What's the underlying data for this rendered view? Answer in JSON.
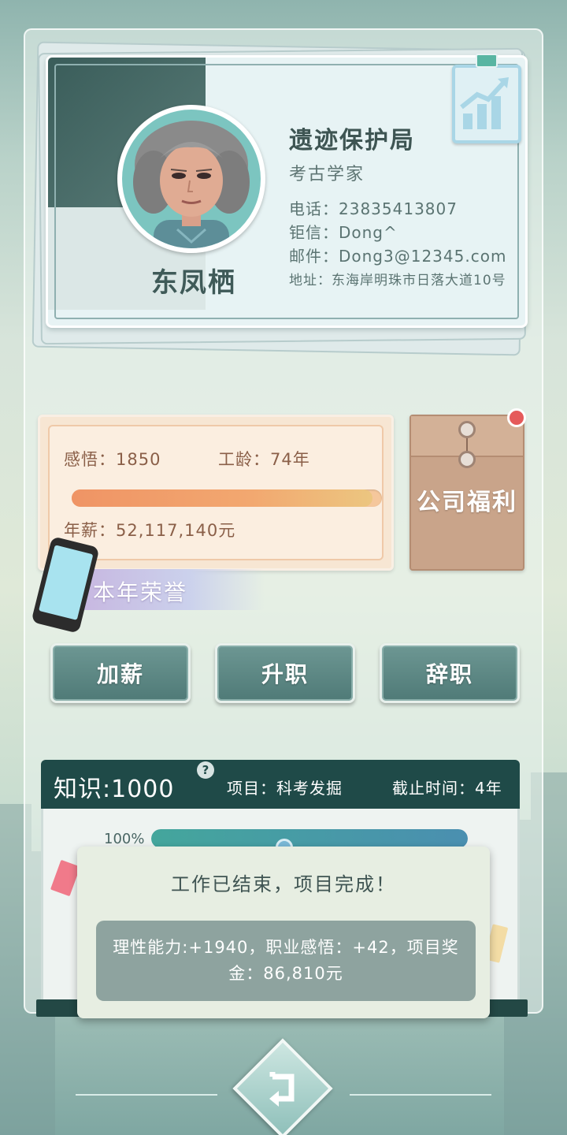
{
  "profile": {
    "name": "东凤栖",
    "organization": "遗迹保护局",
    "job_title": "考古学家",
    "phone": "电话：23835413807",
    "qian_xin": "钜信：Dong^",
    "email": "邮件：Dong3@12345.com",
    "address": "地址：东海岸明珠市日落大道10号"
  },
  "stats": {
    "insight": "感悟：1850",
    "seniority": "工龄：74年",
    "salary": "年薪：52,117,140元",
    "progress_fraction": 0.97
  },
  "welfare": {
    "label": "公司福利",
    "has_notification": true
  },
  "honor": {
    "label": "本年荣誉"
  },
  "actions": {
    "raise": "加薪",
    "promote": "升职",
    "resign": "辞职"
  },
  "knowledge": {
    "value": "知识:1000",
    "help": "?",
    "project": "项目：科考发掘",
    "deadline": "截止时间：4年",
    "percent_text": "100%",
    "progress_fraction": 1.0
  },
  "result": {
    "title": "工作已结束，项目完成！",
    "detail": "理性能力:+1940，职业感悟：+42，项目奖金：86,810元"
  },
  "colors": {
    "header_dark": "#1f4a48",
    "button_teal": "#5b8784",
    "salary_bar": "#f2a870",
    "notification_red": "#e55a5a"
  },
  "icons": {
    "badge": "growth-chart-icon",
    "back": "return-arrow-icon",
    "phone": "smartphone-icon"
  }
}
